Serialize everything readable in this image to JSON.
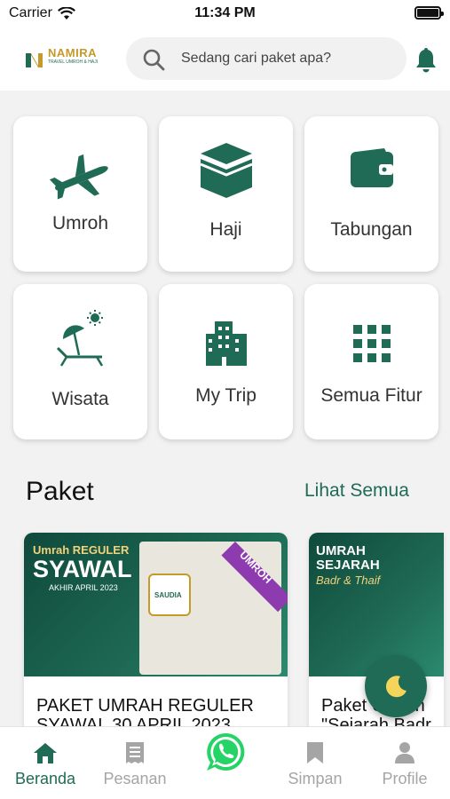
{
  "status_bar": {
    "carrier": "Carrier",
    "time": "11:34 PM"
  },
  "header": {
    "logo_text": "NAMIRA",
    "logo_tagline": "TRAVEL UMROH & HAJI",
    "search_placeholder": "Sedang cari paket apa?"
  },
  "features": [
    {
      "label": "Umroh",
      "icon": "airplane-icon"
    },
    {
      "label": "Haji",
      "icon": "kaaba-icon"
    },
    {
      "label": "Tabungan",
      "icon": "wallet-icon"
    },
    {
      "label": "Wisata",
      "icon": "beach-icon"
    },
    {
      "label": "My Trip",
      "icon": "building-icon"
    },
    {
      "label": "Semua Fitur",
      "icon": "grid-icon"
    }
  ],
  "packages_section": {
    "title": "Paket",
    "see_all": "Lihat Semua",
    "packages": [
      {
        "title": "PAKET UMRAH REGULER",
        "subtitle": "SYAWAL 30 APRIL 2023",
        "banner_top": "Umrah REGULER",
        "banner_main": "SYAWAL",
        "banner_sub": "AKHIR APRIL 2023",
        "badge": "UMROH",
        "airline": "SAUDIA"
      },
      {
        "title": "Paket Umrah",
        "subtitle": "\"Sejarah Badr",
        "banner_top": "UMRAH",
        "banner_main": "SEJARAH",
        "banner_sub": "Badr & Thaif"
      }
    ]
  },
  "tabbar": {
    "tabs": [
      {
        "label": "Beranda",
        "icon": "home-icon",
        "active": true
      },
      {
        "label": "Pesanan",
        "icon": "receipt-icon",
        "active": false
      },
      {
        "label": "",
        "icon": "whatsapp-icon",
        "active": false
      },
      {
        "label": "Simpan",
        "icon": "bookmark-icon",
        "active": false
      },
      {
        "label": "Profile",
        "icon": "person-icon",
        "active": false
      }
    ]
  },
  "colors": {
    "primary": "#1f6b55",
    "gold": "#c59a2a",
    "whatsapp": "#25d366",
    "inactive": "#a5a5a5"
  }
}
